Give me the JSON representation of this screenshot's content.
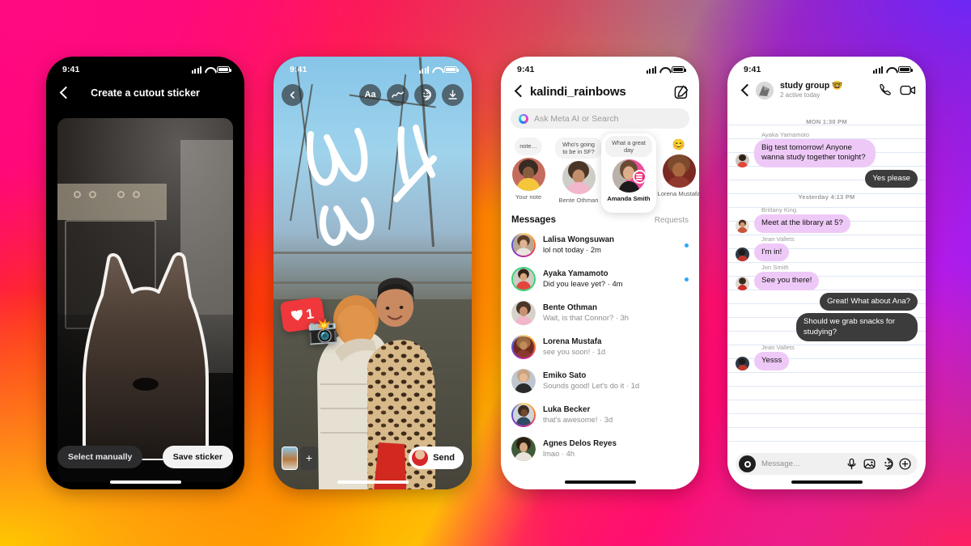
{
  "background": {
    "colors": [
      "#ff0080",
      "#ff2a2a",
      "#ff6a00",
      "#ffc400",
      "#c018e8",
      "#7b2ff7"
    ]
  },
  "phones": {
    "p1": {
      "status": {
        "time": "9:41",
        "signal_icon": "signal-bars-icon",
        "wifi_icon": "wifi-icon",
        "battery_icon": "battery-icon"
      },
      "back_icon": "back-chevron-icon",
      "title": "Create a cutout sticker",
      "photo_subject": "french-bulldog-cutout",
      "select_manually_label": "Select manually",
      "save_sticker_label": "Save sticker"
    },
    "p2": {
      "status": {
        "time": "9:41"
      },
      "back_icon": "back-chevron-icon",
      "tools": [
        {
          "name": "text-tool",
          "label": "Aa"
        },
        {
          "name": "draw-tool",
          "label": "squiggle-icon"
        },
        {
          "name": "sticker-tool",
          "label": "sticker-face-icon"
        },
        {
          "name": "download-tool",
          "label": "download-icon"
        }
      ],
      "stickers": [
        {
          "name": "like-count-sticker",
          "count": "1",
          "icon": "heart-icon",
          "color": "#f0383c"
        },
        {
          "name": "camera-flash-sticker",
          "glyph": "📸"
        }
      ],
      "thumb_add_label": "+",
      "send_label": "Send"
    },
    "p3": {
      "status": {
        "time": "9:41"
      },
      "back_icon": "back-chevron-icon",
      "username": "kalindi_rainbows",
      "compose_icon": "compose-pencil-icon",
      "search": {
        "placeholder": "Ask Meta AI or Search",
        "icon": "meta-ai-ring-icon"
      },
      "notes": [
        {
          "bubble": "note…",
          "label": "Your note",
          "active": false,
          "emoji": false
        },
        {
          "bubble": "Who's going to be in SF?",
          "label": "Bente Othman",
          "active": false,
          "emoji": false
        },
        {
          "bubble": "What a great day",
          "label": "Amanda Smith",
          "active": true,
          "emoji": false,
          "badge": "notes-badge-icon"
        },
        {
          "bubble": "😊",
          "label": "Lorena Mustafa",
          "active": false,
          "emoji": true
        }
      ],
      "messages_header": "Messages",
      "requests_label": "Requests",
      "conversations": [
        {
          "name": "Lalisa Wongsuwan",
          "preview": "lol not today · 2m",
          "unread": true
        },
        {
          "name": "Ayaka Yamamoto",
          "preview": "Did you leave yet? · 4m",
          "unread": true
        },
        {
          "name": "Bente Othman",
          "preview": "Wait, is that Connor? · 3h",
          "unread": false
        },
        {
          "name": "Lorena Mustafa",
          "preview": "see you soon! · 1d",
          "unread": false
        },
        {
          "name": "Emiko Sato",
          "preview": "Sounds good! Let's do it · 1d",
          "unread": false
        },
        {
          "name": "Luka Becker",
          "preview": "that's awesome! · 3d",
          "unread": false
        },
        {
          "name": "Agnes Delos Reyes",
          "preview": "lmao · 4h",
          "unread": false
        }
      ]
    },
    "p4": {
      "status": {
        "time": "9:41"
      },
      "back_icon": "back-chevron-icon",
      "group_name": "study group 🤓",
      "group_status": "2 active today",
      "call_icon": "phone-call-icon",
      "video_icon": "video-camera-icon",
      "thread": [
        {
          "type": "separator",
          "text": "MON 1:30 PM"
        },
        {
          "type": "in",
          "sender": "Ayaka Yamamoto",
          "text": "Big test tomorrow! Anyone wanna study together tonight?"
        },
        {
          "type": "out",
          "text": "Yes please"
        },
        {
          "type": "separator",
          "text": "Yesterday 4:13 PM"
        },
        {
          "type": "in",
          "sender": "Brittany King",
          "text": "Meet at the library at 5?"
        },
        {
          "type": "in",
          "sender": "Jean Vallets",
          "text": "I'm in!"
        },
        {
          "type": "in",
          "sender": "Jon Smith",
          "text": "See you there!"
        },
        {
          "type": "out",
          "text": "Great! What about Ana?"
        },
        {
          "type": "out",
          "text": "Should we grab snacks for studying?"
        },
        {
          "type": "in",
          "sender": "Jean Vallets",
          "text": "Yesss"
        }
      ],
      "composer": {
        "camera_icon": "camera-circle-icon",
        "placeholder": "Message…",
        "icons": [
          "microphone-icon",
          "photo-icon",
          "sticker-icon",
          "plus-circle-icon"
        ]
      }
    }
  }
}
